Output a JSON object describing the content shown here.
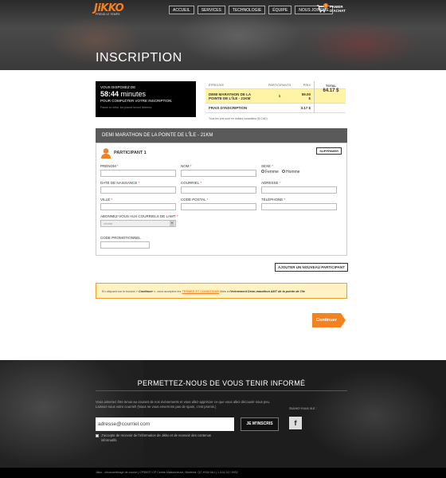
{
  "header": {
    "logo": "JiKKO",
    "logo_tagline": "PREND LE TEMPS",
    "nav": [
      "ACCUEIL",
      "SERVICES",
      "TECHNOLOGIE",
      "ÉQUIPE",
      "NOUS JOINDRE"
    ],
    "cart_count": "1",
    "cart_label": "PANIER D'ACHAT"
  },
  "page_title": "INSCRIPTION",
  "timer": {
    "line1": "VOUS DISPOSEZ DE",
    "time": "58:44",
    "unit": "minutes",
    "line3": "POUR COMPLÉTER VOTRE INSCRIPTION.",
    "note": "Passé ce délai, les places seront libérées."
  },
  "summary": {
    "headers": [
      "ÉPREUVE",
      "PARTICIPANTS",
      "PRIX"
    ],
    "rows": [
      {
        "event": "DEMI MARATHON DE LA POINTE DE L'ÎLE - 21KM",
        "participants": "1",
        "price": "59.00 $"
      },
      {
        "event": "FRAIS D'INSCRIPTION",
        "participants": "",
        "price": "3.17 $"
      }
    ],
    "note": "Tous les prix sont en dollars canadiens ($ CAD)",
    "total_label": "TOTAL",
    "total_value": "64.17 $"
  },
  "race_title": "DEMI MARATHON DE LA POINTE DE L'ÎLE - 21KM",
  "participant": {
    "title": "PARTICIPANT 1",
    "delete_label": "SUPPRIMER",
    "fields": {
      "prenom": "PRÉNOM",
      "nom": "NOM",
      "sexe": "SEXE",
      "sexe_femme": "Femme",
      "sexe_homme": "Homme",
      "naissance": "DATE DE NAISSANCE",
      "courriel": "COURRIEL",
      "adresse": "ADRESSE",
      "ville": "VILLE",
      "postal": "CODE POSTAL",
      "telephone": "TÉLÉPHONE",
      "abonner": "ABONNEZ-VOUS AUX COURRIELS DE LAMT",
      "abonner_value": "choisir",
      "promo": "CODE PROMOTIONNEL"
    },
    "required_mark": "*"
  },
  "add_participant_label": "AJOUTER UN NOUVEAU PARTICIPANT",
  "terms": {
    "prefix": "En cliquant sur le bouton « ",
    "button_ref": "Continuer",
    "middle": " », vous acceptez les ",
    "link": "TERMES ET CONDITIONS",
    "middle2": " liées à ",
    "event": "l'événement Demi-marathon AMT de la pointe de l'île"
  },
  "continue_label": "Continuer",
  "newsletter": {
    "title": "PERMETTEZ-NOUS DE VOUS TENIR INFORMÉ",
    "text": "Vous aimeriez être tenus au courant de nos événements et vous allez apprécier ce que vous allez découvrir sous peu. Laissez-nous votre courriel! (Nous ne vous enverrons pas de spam, c'est promis.)",
    "email_placeholder": "adresse@courriel.com",
    "subscribe_label": "JE M'INSCRIS",
    "consent": "J'accepte de recevoir de l'information de Jikko et de recevoir des contenus informatifs.",
    "follow_label": "Suivez-nous sur :",
    "facebook": "f"
  },
  "footer": {
    "copyright": "Jikko - chronométrage de course | CP55037 CP Centre Maisonneuve, Montréal, QC H1W 0A1 | 1-514-247-9932"
  }
}
